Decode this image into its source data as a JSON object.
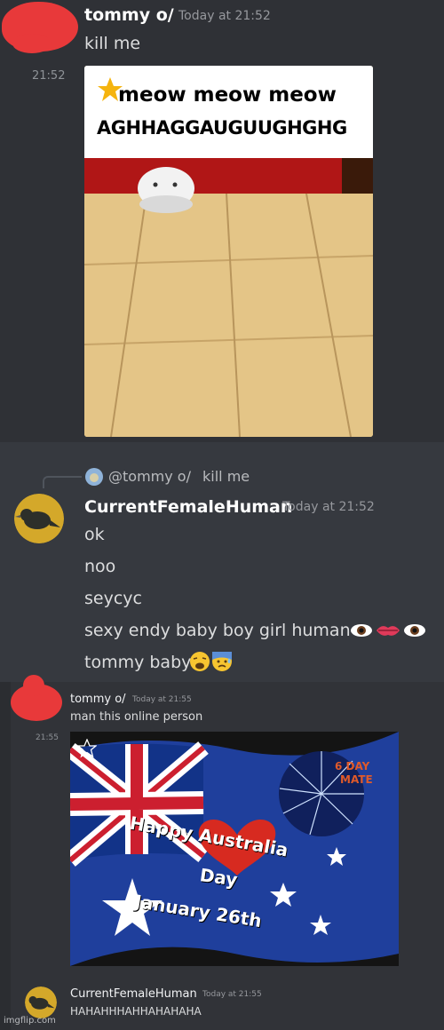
{
  "messages": [
    {
      "author": "tommy o/",
      "timestamp": "Today at 21:52",
      "text": "kill me"
    },
    {
      "side_time": "21:52",
      "gif_caption_line1": "meow meow meow",
      "gif_caption_line2": "AGHHAGGAUGUUGHGHG"
    },
    {
      "reply_author": "@tommy o/",
      "reply_text": "kill me",
      "author": "CurrentFemaleHuman",
      "timestamp": "Today at 21:52",
      "lines": [
        "ok",
        "noo",
        "seycyc",
        "sexy endy baby boy girl human",
        "tommy baby"
      ]
    },
    {
      "author": "tommy o/",
      "timestamp": "Today at 21:55",
      "text": "man this online person",
      "side_time": "21:55",
      "gif_text": [
        "Happy Australia",
        "Day",
        "January 26th"
      ],
      "gif_badge": [
        "6 DAY",
        "MATE"
      ]
    },
    {
      "author": "CurrentFemaleHuman",
      "timestamp": "Today at 21:55",
      "text": "HAHAHHHAHHAHAHAHA"
    }
  ],
  "watermark": "imgflip.com",
  "colors": {
    "background": "#36393f",
    "panel": "#2f3136",
    "name": "#ffffff",
    "text": "#dcddde",
    "timestamp": "#96989d"
  }
}
